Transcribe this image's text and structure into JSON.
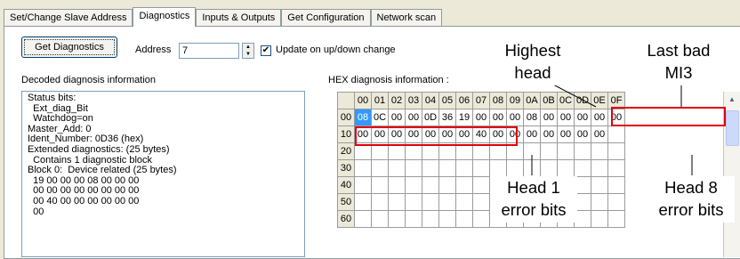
{
  "tabs": [
    "Set/Change Slave Address",
    "Diagnostics",
    "Inputs & Outputs",
    "Get Configuration",
    "Network scan"
  ],
  "active_tab": "Diagnostics",
  "toolbar": {
    "get_diagnostics_label": "Get Diagnostics",
    "address_label": "Address",
    "address_value": "7",
    "update_label": "Update on up/down change",
    "update_checked": true
  },
  "decoded": {
    "header": "Decoded diagnosis information",
    "lines": [
      "Status bits:",
      "  Ext_diag_Bit",
      "  Watchdog=on",
      "Master_Add: 0",
      "Ident_Number: 0D36 (hex)",
      "Extended diagnostics: (25 bytes)",
      "  Contains 1 diagnostic block",
      "Block 0:  Device related (25 bytes)",
      "  19 00 00 00 08 00 00 00",
      "  00 00 00 00 00 00 00 00",
      "  00 40 00 00 00 00 00 00",
      "  00"
    ]
  },
  "hex": {
    "header": "HEX diagnosis information :",
    "col_headers": [
      "00",
      "01",
      "02",
      "03",
      "04",
      "05",
      "06",
      "07",
      "08",
      "09",
      "0A",
      "0B",
      "0C",
      "0D",
      "0E",
      "0F"
    ],
    "rows": [
      {
        "label": "00",
        "cells": [
          "08",
          "0C",
          "00",
          "00",
          "0D",
          "36",
          "19",
          "00",
          "00",
          "00",
          "08",
          "00",
          "00",
          "00",
          "00",
          "00"
        ]
      },
      {
        "label": "10",
        "cells": [
          "00",
          "00",
          "00",
          "00",
          "00",
          "00",
          "00",
          "40",
          "00",
          "00",
          "00",
          "00",
          "00",
          "00",
          "00",
          ""
        ]
      },
      {
        "label": "20",
        "cells": [
          "",
          "",
          "",
          "",
          "",
          "",
          "",
          "",
          "",
          "",
          "",
          "",
          "",
          "",
          "",
          ""
        ]
      },
      {
        "label": "30",
        "cells": [
          "",
          "",
          "",
          "",
          "",
          "",
          "",
          "",
          "",
          "",
          "",
          "",
          "",
          "",
          "",
          ""
        ]
      },
      {
        "label": "40",
        "cells": [
          "",
          "",
          "",
          "",
          "",
          "",
          "",
          "",
          "",
          "",
          "",
          "",
          "",
          "",
          "",
          ""
        ]
      },
      {
        "label": "50",
        "cells": [
          "",
          "",
          "",
          "",
          "",
          "",
          "",
          "",
          "",
          "",
          "",
          "",
          "",
          "",
          "",
          ""
        ]
      },
      {
        "label": "60",
        "cells": [
          "",
          "",
          "",
          "",
          "",
          "",
          "",
          "",
          "",
          "",
          "",
          "",
          "",
          "",
          "",
          ""
        ]
      }
    ],
    "selected_cell": {
      "row": 0,
      "col": 0
    }
  },
  "annotations": {
    "highest_head": [
      "Highest",
      "head"
    ],
    "last_bad_mi3": [
      "Last bad",
      "MI3"
    ],
    "head1": [
      "Head 1",
      "error bits"
    ],
    "head8": [
      "Head 8",
      "error bits"
    ]
  },
  "colors": {
    "annotation": "#e0000e",
    "selection": "#3399ff"
  }
}
